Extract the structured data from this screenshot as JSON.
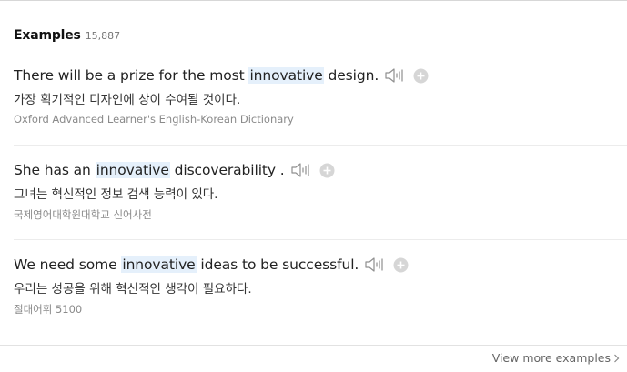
{
  "section": {
    "title": "Examples",
    "count": "15,887"
  },
  "examples": [
    {
      "before": "There will be a prize for the most ",
      "highlight": "innovative",
      "after": " design.",
      "translation": "가장 획기적인 디자인에 상이 수여될 것이다.",
      "source": "Oxford Advanced Learner's English-Korean Dictionary"
    },
    {
      "before": "She has an ",
      "highlight": "innovative",
      "after": " discoverability .",
      "translation": "그녀는 혁신적인 정보 검색 능력이 있다.",
      "source": "국제영어대학원대학교 신어사전"
    },
    {
      "before": "We need some ",
      "highlight": "innovative",
      "after": " ideas to be successful.",
      "translation": "우리는 성공을 위해 혁신적인 생각이 필요하다.",
      "source": "절대어휘 5100"
    }
  ],
  "footer": {
    "view_more_label": "View more examples"
  },
  "icons": {
    "speaker": "speaker-icon",
    "add": "add-icon",
    "chevron": "chevron-right-icon"
  },
  "colors": {
    "highlight_background": "#e5f0fb",
    "text": "#222222",
    "muted_text": "#8a8a8a",
    "icon_gray": "#9a9a9a",
    "add_circle": "#d6d6d6"
  }
}
